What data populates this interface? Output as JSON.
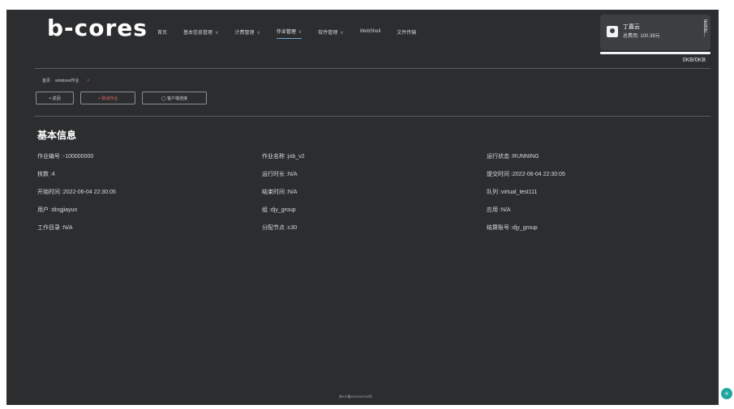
{
  "app": {
    "logo": "b-cores"
  },
  "nav": {
    "items": [
      {
        "label": "首页",
        "dropdown": false,
        "active": false
      },
      {
        "label": "基本信息管理",
        "dropdown": true,
        "active": false
      },
      {
        "label": "计费管理",
        "dropdown": true,
        "active": false
      },
      {
        "label": "作业管理",
        "dropdown": true,
        "active": true
      },
      {
        "label": "软件管理",
        "dropdown": true,
        "active": false
      },
      {
        "label": "WebShell",
        "dropdown": false,
        "active": false
      },
      {
        "label": "文件传输",
        "dropdown": false,
        "active": false
      }
    ],
    "chevron": "∨"
  },
  "user": {
    "name": "丁嘉云",
    "balance": "总费用: 100.38元",
    "vertical_label": "testdu..."
  },
  "quota": {
    "text": "0KB/0KB"
  },
  "breadcrumb": {
    "home": "首页",
    "current": "windows作业",
    "close": "×"
  },
  "actions": {
    "back": "< 返回",
    "cancel": "× 取消作业",
    "connect": "◯ 客户端连接"
  },
  "section": {
    "title": "基本信息"
  },
  "info": [
    "作业编号 :-100000000",
    "作业名称 :job_v2",
    "运行状态 :RUNNING",
    "核数 :4",
    "运行时长 :N/A",
    "提交时间 :2022-06-04 22:30:05",
    "开始时间 :2022-06-04 22:30:05",
    "结束时间 :N/A",
    "队列 :virtual_test111",
    "用户 :dingjiayun",
    "组 :djy_group",
    "应用 :N/A",
    "工作目录 :N/A",
    "分配节点 :c30",
    "结算账号 :djy_group"
  ],
  "footer": {
    "icp": "苏ICP备2022018765号"
  },
  "fab": {
    "label": "+"
  },
  "colors": {
    "background": "#2b2d2f",
    "accent": "#6fa8d6",
    "danger": "#e26b6b",
    "fab": "#1fa7a0"
  }
}
